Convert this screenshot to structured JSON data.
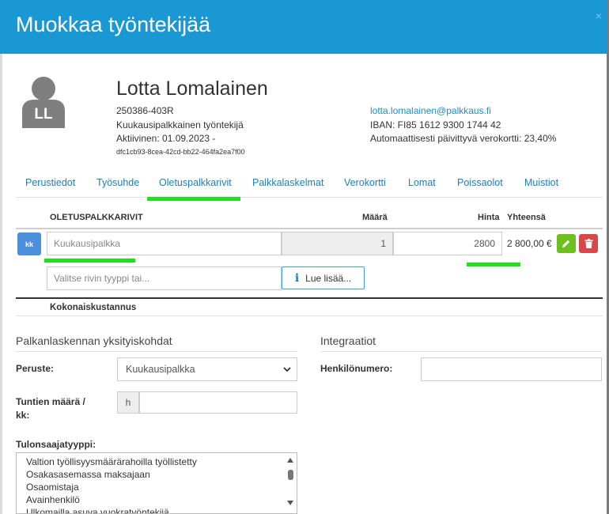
{
  "header": {
    "title": "Muokkaa työntekijää",
    "close": "×"
  },
  "employee": {
    "avatar_initials": "LL",
    "name": "Lotta Lomalainen",
    "id": "250386-403R",
    "type": "Kuukausipalkkainen työntekijä",
    "active": "Aktiivinen: 01.09.2023 -",
    "uuid": "dfc1cb93-8cea-42cd-bb22-464fa2ea7f00",
    "email": "lotta.lomalainen@palkkaus.fi",
    "iban": "IBAN: FI85 1612 9300 1744 42",
    "taxcard": "Automaattisesti päivittyvä verokortti: 23,40%"
  },
  "tabs": [
    {
      "label": "Perustiedot"
    },
    {
      "label": "Työsuhde"
    },
    {
      "label": "Oletuspalkkarivit",
      "active": true
    },
    {
      "label": "Palkkalaskelmat"
    },
    {
      "label": "Verokortti"
    },
    {
      "label": "Lomat"
    },
    {
      "label": "Poissaolot"
    },
    {
      "label": "Muistiot"
    }
  ],
  "salary_table": {
    "headers": {
      "title": "OLETUSPALKKARIVIT",
      "amount": "Määrä",
      "price": "Hinta",
      "total": "Yhteensä"
    },
    "row": {
      "type_badge": "kk",
      "description_placeholder": "Kuukausipalkka",
      "amount": "1",
      "price": "2800",
      "total": "2 800,00 €"
    },
    "new_row_placeholder": "Valitse rivin tyyppi tai...",
    "read_more": "Lue lisää...",
    "total_label": "Kokonaiskustannus"
  },
  "details": {
    "title": "Palkanlaskennan yksityiskohdat",
    "basis_label": "Peruste:",
    "basis_value": "Kuukausipalkka",
    "hours_label_1": "Tuntien määrä /",
    "hours_label_2": "kk:",
    "hours_unit": "h",
    "hours_value": "",
    "income_type_label": "Tulonsaajatyyppi:",
    "income_types": [
      "Valtion työllisyysmäärärahoilla työllistetty",
      "Osakasasemassa maksajaan",
      "Osaomistaja",
      "Avainhenkilö",
      "Ulkomailla asuva vuokratyöntekijä"
    ]
  },
  "integrations": {
    "title": "Integraatiot",
    "person_number_label": "Henkilönumero:",
    "person_number_value": ""
  },
  "colors": {
    "header_bg": "#1a98d4",
    "link": "#1a7fbf",
    "highlight": "#1ee01e",
    "edit": "#6fbf1e",
    "delete": "#d94848",
    "badge": "#4d8fdb"
  }
}
